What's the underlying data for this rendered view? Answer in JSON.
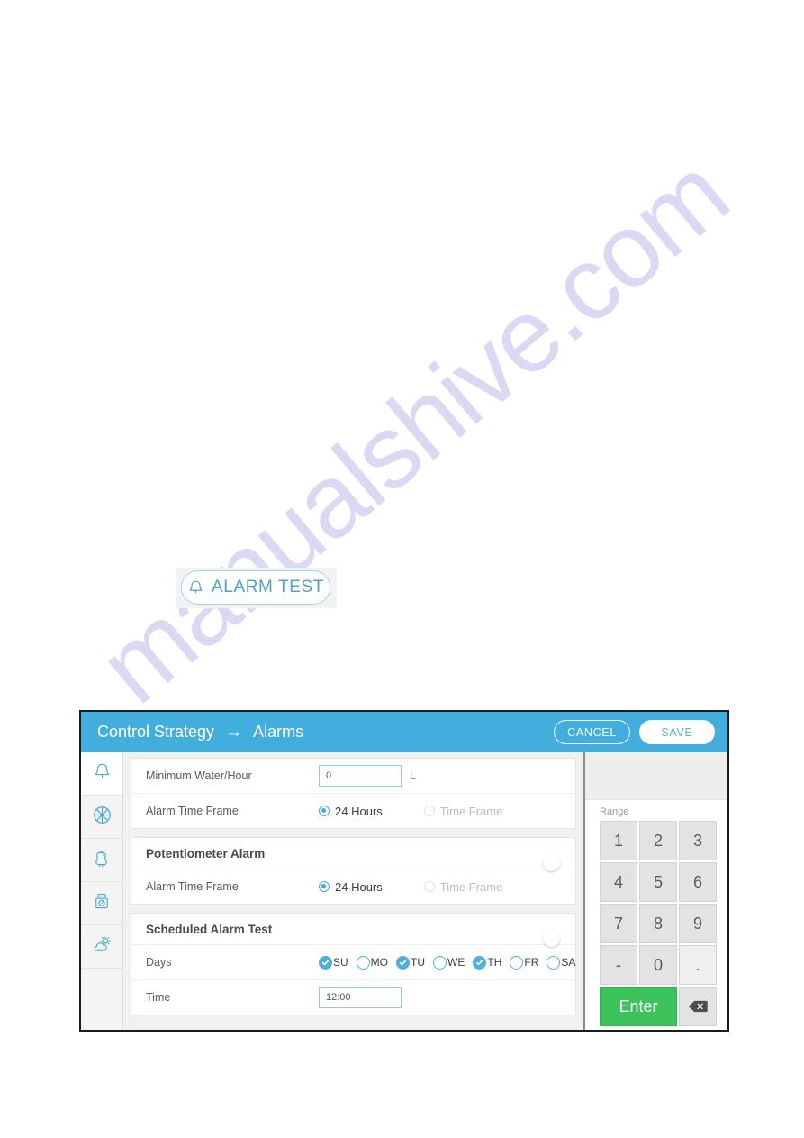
{
  "watermark": {
    "text": "manualshive.com"
  },
  "alarm_test_button": {
    "label": "ALARM TEST",
    "icon": "bell-icon"
  },
  "device": {
    "topbar": {
      "breadcrumb_parent": "Control Strategy",
      "breadcrumb_arrow": "→",
      "breadcrumb_current": "Alarms",
      "cancel_label": "CANCEL",
      "save_label": "SAVE",
      "bg_color": "#42aedd"
    },
    "rail": {
      "items": [
        {
          "icon": "bell-icon",
          "name": "alarms",
          "active": true
        },
        {
          "icon": "fan-icon",
          "name": "ventilation",
          "active": false
        },
        {
          "icon": "rooster-icon",
          "name": "birds",
          "active": false
        },
        {
          "icon": "scale-icon",
          "name": "weighing",
          "active": false
        },
        {
          "icon": "weather-icon",
          "name": "climate",
          "active": false
        }
      ]
    },
    "sections": [
      {
        "name": "water-alarm-section",
        "has_header": false,
        "rows": [
          {
            "type": "text-input",
            "label": "Minimum Water/Hour",
            "value": "0",
            "unit": "L"
          },
          {
            "type": "radio",
            "label": "Alarm Time Frame",
            "options": [
              {
                "label": "24 Hours",
                "selected": true
              },
              {
                "label": "Time Frame",
                "selected": false
              }
            ]
          }
        ]
      },
      {
        "name": "potentiometer-alarm-section",
        "has_header": true,
        "header": "Potentiometer Alarm",
        "toggle_on": true,
        "rows": [
          {
            "type": "radio",
            "label": "Alarm Time Frame",
            "options": [
              {
                "label": "24 Hours",
                "selected": true
              },
              {
                "label": "Time Frame",
                "selected": false
              }
            ]
          }
        ]
      },
      {
        "name": "scheduled-alarm-test-section",
        "has_header": true,
        "header": "Scheduled Alarm Test",
        "toggle_on": true,
        "rows": [
          {
            "type": "days",
            "label": "Days",
            "days": [
              {
                "label": "SU",
                "checked": true
              },
              {
                "label": "MO",
                "checked": false
              },
              {
                "label": "TU",
                "checked": true
              },
              {
                "label": "WE",
                "checked": false
              },
              {
                "label": "TH",
                "checked": true
              },
              {
                "label": "FR",
                "checked": false
              },
              {
                "label": "SA",
                "checked": false
              }
            ]
          },
          {
            "type": "text-input",
            "label": "Time",
            "value": "12:00",
            "unit": ""
          }
        ]
      }
    ],
    "keypad": {
      "range_label": "Range",
      "keys": [
        "1",
        "2",
        "3",
        "4",
        "5",
        "6",
        "7",
        "8",
        "9",
        "-",
        "0",
        "."
      ],
      "enter_label": "Enter",
      "backspace_icon": "backspace-icon",
      "enter_color": "#3cc35c"
    }
  }
}
